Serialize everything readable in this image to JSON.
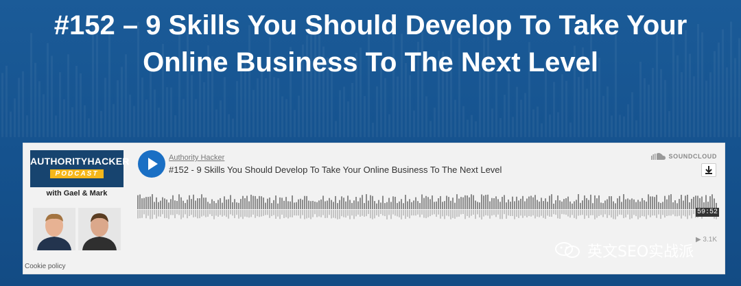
{
  "page": {
    "title_line1": "#152 – 9 Skills You Should Develop To Take Your",
    "title_line2": "Online Business To The Next Level"
  },
  "artwork": {
    "brand": "AUTHORITYHACKER",
    "podcast_label": "PODCAST",
    "subtitle": "with Gael & Mark"
  },
  "player": {
    "author": "Authority Hacker",
    "track_title": "#152 - 9 Skills You Should Develop To Take Your Online Business To The Next Level",
    "brand": "SOUNDCLOUD",
    "duration": "59:52",
    "plays": "3.1K",
    "cookie_policy": "Cookie policy",
    "icons": [
      "play-icon",
      "soundcloud-icon",
      "download-icon",
      "play-count-icon"
    ]
  },
  "watermark": {
    "text": "英文SEO实战派",
    "icon": "wechat-icon"
  },
  "colors": {
    "background": "#15528e",
    "play_button": "#1a6fc4",
    "artwork_bg": "#17446f",
    "podcast_badge": "#f5b71a",
    "waveform": "#8a8a8a"
  }
}
